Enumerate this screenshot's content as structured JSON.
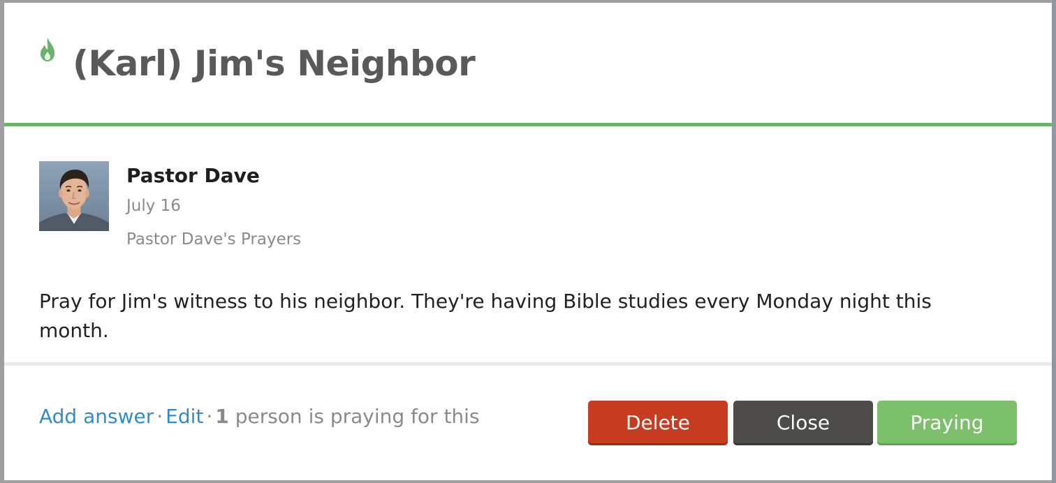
{
  "modal": {
    "title": "(Karl) Jim's Neighbor",
    "icon": "flame-icon",
    "accent_color": "#6cb26a"
  },
  "post": {
    "author": "Pastor Dave",
    "date": "July 16",
    "list_name": "Pastor Dave's Prayers",
    "text": "Pray for Jim's witness to his neighbor. They're having Bible studies every Monday night this month.",
    "avatar": "author-avatar"
  },
  "footer": {
    "add_answer": "Add answer",
    "separator": "·",
    "edit": "Edit",
    "praying_count": "1",
    "praying_text": "person is praying for this"
  },
  "buttons": {
    "delete": "Delete",
    "close": "Close",
    "praying": "Praying",
    "delete_color": "#c63c21",
    "close_color": "#4e4c48",
    "praying_color": "#7dc06c"
  }
}
